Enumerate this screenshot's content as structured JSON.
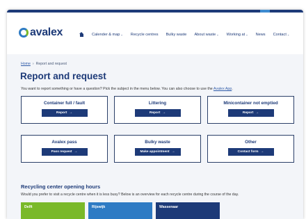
{
  "colors": {
    "brand_navy": "#1d3a78",
    "brand_blue": "#2e7bc4",
    "brand_green": "#7ab929",
    "tile_green": "#7ab929",
    "tile_blue": "#2e7bc4",
    "tile_navy": "#1d3a78"
  },
  "logo": {
    "text": "avalex"
  },
  "nav": {
    "items": [
      {
        "label": "Calender & map",
        "icon": "chevron-down-icon"
      },
      {
        "label": "Recycle centres"
      },
      {
        "label": "Bulky waste"
      },
      {
        "label": "About waste",
        "icon": "chevron-down-icon"
      },
      {
        "label": "Working at",
        "icon": "chevron-down-icon"
      },
      {
        "label": "News"
      },
      {
        "label": "Contact",
        "icon": "chevron-down-icon"
      }
    ],
    "chevron": "⌄"
  },
  "breadcrumb": {
    "home": "Home",
    "separator": "›",
    "current": "Report and request"
  },
  "page": {
    "title": "Report and request",
    "intro": "You want to report something or have a question? Pick the subject in the menu below. You can also choose to use the",
    "intro_link": "Avalex App",
    "intro_end": "."
  },
  "cards": [
    {
      "title": "Container full / fault",
      "button": "Report",
      "arrow": "→"
    },
    {
      "title": "Littering",
      "button": "Report",
      "arrow": "→"
    },
    {
      "title": "Minicontainer not emptied",
      "button": "Report",
      "arrow": "→"
    },
    {
      "title": "Avalex pass",
      "button": "Pass request",
      "arrow": "→"
    },
    {
      "title": "Bulky waste",
      "button": "Make appointment",
      "arrow": "→"
    },
    {
      "title": "Other",
      "button": "Contact form",
      "arrow": "→"
    }
  ],
  "recycling": {
    "title": "Recycling center opening hours",
    "subtitle": "Would you prefer to visit a recycle centre when it is less busy? Below is an overview for each recycle centre during the course of the day.",
    "tiles": [
      "Delft",
      "Rijswijk",
      "Wassenaar"
    ]
  }
}
